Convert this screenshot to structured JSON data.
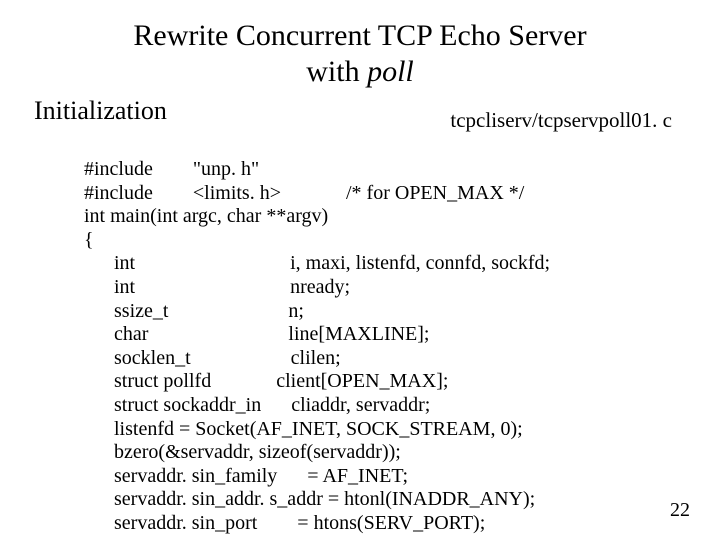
{
  "title_line1": "Rewrite Concurrent TCP Echo Server",
  "title_line2_prefix": "with ",
  "title_line2_italic": "poll",
  "subhead_left": "Initialization",
  "subhead_right": "tcpcliserv/tcpservpoll01. c",
  "code": "#include        \"unp. h\"\n#include        <limits. h>             /* for OPEN_MAX */\nint main(int argc, char **argv)\n{\n      int                               i, maxi, listenfd, connfd, sockfd;\n      int                               nready;\n      ssize_t                        n;\n      char                            line[MAXLINE];\n      socklen_t                    clilen;\n      struct pollfd             client[OPEN_MAX];\n      struct sockaddr_in      cliaddr, servaddr;\n      listenfd = Socket(AF_INET, SOCK_STREAM, 0);\n      bzero(&servaddr, sizeof(servaddr));\n      servaddr. sin_family      = AF_INET;\n      servaddr. sin_addr. s_addr = htonl(INADDR_ANY);\n      servaddr. sin_port        = htons(SERV_PORT);",
  "page_number": "22"
}
